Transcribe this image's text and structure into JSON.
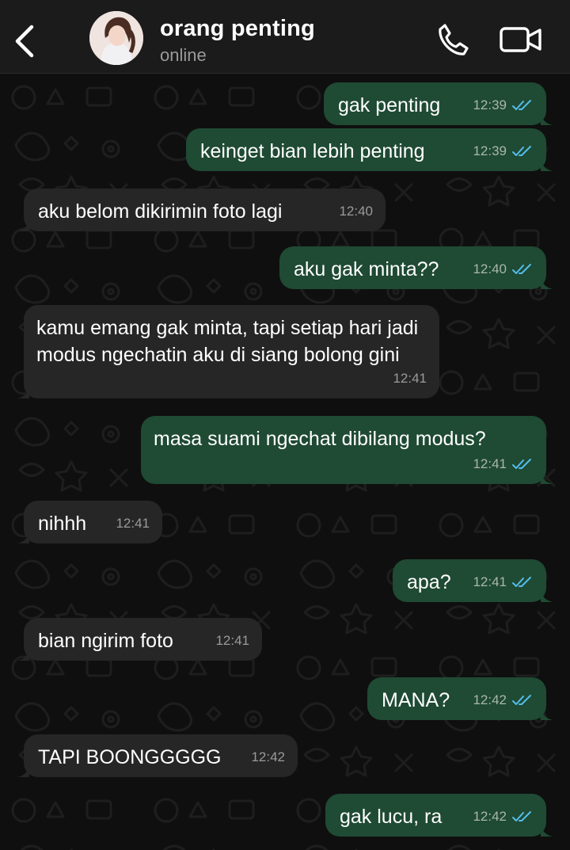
{
  "header": {
    "back_icon": "chevron-left-icon",
    "contact_name": "orang penting",
    "status": "online",
    "call_icon": "phone-icon",
    "video_icon": "video-camera-icon"
  },
  "colors": {
    "header_bg": "#1b1b1b",
    "chat_bg": "#0f0f0f",
    "outgoing_bubble": "#1f4a33",
    "incoming_bubble": "#262626",
    "read_ticks": "#53bdeb"
  },
  "messages": [
    {
      "dir": "out",
      "text": "gak penting",
      "time": "12:39",
      "ticks": "read"
    },
    {
      "dir": "out",
      "text": "keinget bian lebih penting",
      "time": "12:39",
      "ticks": "read"
    },
    {
      "dir": "in",
      "text": "aku belom dikirimin foto lagi",
      "time": "12:40"
    },
    {
      "dir": "out",
      "text": "aku gak minta??",
      "time": "12:40",
      "ticks": "read"
    },
    {
      "dir": "in",
      "text": "kamu emang gak minta, tapi setiap hari jadi modus ngechatin aku di siang bolong gini",
      "time": "12:41"
    },
    {
      "dir": "out",
      "text": "masa suami ngechat dibilang modus?",
      "time": "12:41",
      "ticks": "read"
    },
    {
      "dir": "in",
      "text": "nihhh",
      "time": "12:41"
    },
    {
      "dir": "out",
      "text": "apa?",
      "time": "12:41",
      "ticks": "read"
    },
    {
      "dir": "in",
      "text": "bian ngirim foto",
      "time": "12:41"
    },
    {
      "dir": "out",
      "text": "MANA?",
      "time": "12:42",
      "ticks": "read"
    },
    {
      "dir": "in",
      "text": "TAPI BOONGGGGG",
      "time": "12:42"
    },
    {
      "dir": "out",
      "text": "gak lucu, ra",
      "time": "12:42",
      "ticks": "read"
    }
  ]
}
